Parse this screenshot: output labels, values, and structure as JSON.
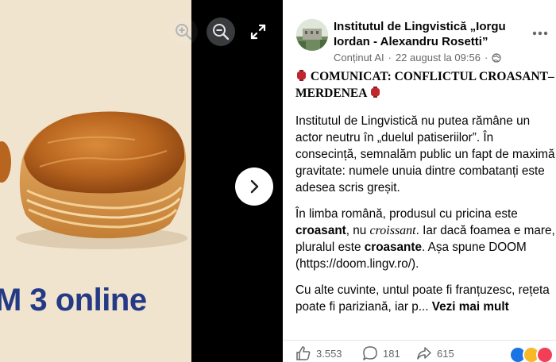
{
  "viewer": {
    "promo_text": "M 3 online",
    "icons": {
      "zoom_in": "zoom-in-icon",
      "zoom_out": "zoom-out-icon",
      "fullscreen": "fullscreen-icon",
      "next": "chevron-right-icon"
    }
  },
  "post": {
    "author": "Institutul de Lingvistică „Iorgu Iordan - Alexandru Rosetti”",
    "meta_source": "Conținut AI",
    "meta_date": "22 august la 09:56",
    "meta_separator": "·",
    "headline": "COMUNICAT: CONFLICTUL CROASANT–MERDENEA",
    "p1": "Institutul de Lingvistică nu putea rămâne un actor neutru în „duelul patiseriilor”. În consecință, semnalăm public un fapt de maximă gravitate: numele unuia dintre combatanți este adesea scris greșit.",
    "p2_a": "În limba română, produsul cu pricina este ",
    "p2_b": "croasant",
    "p2_c": ", nu ",
    "p2_d": "croissant",
    "p2_e": ". Iar dacă foamea e mare, pluralul este ",
    "p2_f": "croasante",
    "p2_g": ". Așa spune DOOM (",
    "p2_link": "https://doom.lingv.ro/",
    "p2_h": ").",
    "p3": "Cu alte cuvinte, untul poate fi franțuzesc, rețeta poate fi pariziană, iar p... ",
    "see_more": "Vezi mai mult"
  },
  "stats": {
    "likes": "3.553",
    "comments": "181",
    "shares": "615"
  },
  "colors": {
    "link": "#216fdb",
    "promo": "#243a86",
    "photo_bg": "#f1e4cf"
  }
}
